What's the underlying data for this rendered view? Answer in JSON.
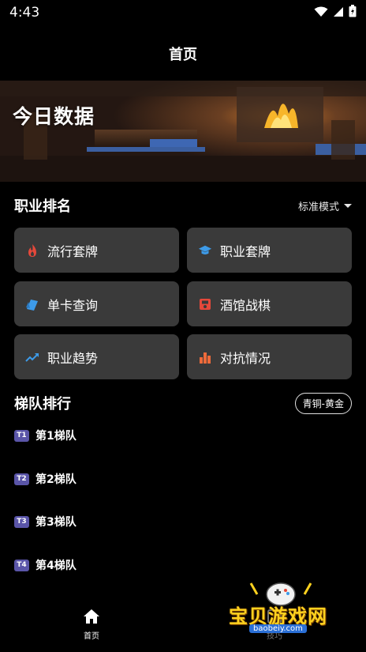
{
  "status_bar": {
    "time": "4:43",
    "icons": [
      "wifi-icon",
      "signal-icon",
      "battery-icon"
    ]
  },
  "app_bar": {
    "title": "首页"
  },
  "banner": {
    "title": "今日数据"
  },
  "ranking": {
    "title": "职业排名",
    "mode": "标准模式",
    "cards": [
      {
        "label": "流行套牌",
        "icon": "flame-icon",
        "color": "#e5483a"
      },
      {
        "label": "职业套牌",
        "icon": "graduation-cap-icon",
        "color": "#3d9be9"
      },
      {
        "label": "单卡查询",
        "icon": "cards-icon",
        "color": "#3d9be9"
      },
      {
        "label": "酒馆战棋",
        "icon": "tavern-icon",
        "color": "#e5483a"
      },
      {
        "label": "职业趋势",
        "icon": "trending-up-icon",
        "color": "#3d9be9"
      },
      {
        "label": "对抗情况",
        "icon": "bar-chart-icon",
        "color": "#ee6a3a"
      }
    ]
  },
  "tiers": {
    "title": "梯队排行",
    "filter": "青铜-黄金",
    "items": [
      {
        "badge": "T1",
        "label": "第1梯队"
      },
      {
        "badge": "T2",
        "label": "第2梯队"
      },
      {
        "badge": "T3",
        "label": "第3梯队"
      },
      {
        "badge": "T4",
        "label": "第4梯队"
      }
    ]
  },
  "bottom_nav": {
    "home_label": "首页",
    "other_label": "技巧"
  },
  "watermark": {
    "text": "宝贝游戏网",
    "url": "baobeiy.com"
  },
  "colors": {
    "background": "#000000",
    "card": "#3a3a3a",
    "tier_badge": "#5a55a8"
  }
}
